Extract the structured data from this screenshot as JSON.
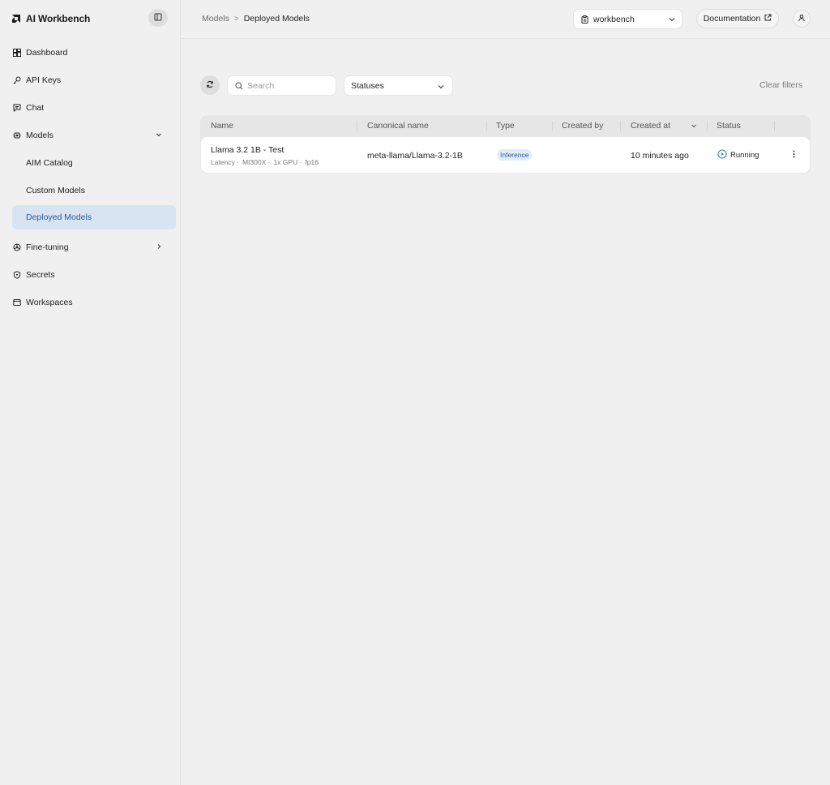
{
  "app": {
    "title": "AI Workbench"
  },
  "sidebar": {
    "items": [
      {
        "label": "Dashboard",
        "icon": "dashboard-icon"
      },
      {
        "label": "API Keys",
        "icon": "key-icon"
      },
      {
        "label": "Chat",
        "icon": "chat-icon"
      },
      {
        "label": "Models",
        "icon": "chip-icon",
        "expanded": true
      },
      {
        "label": "AIM Catalog"
      },
      {
        "label": "Custom Models"
      },
      {
        "label": "Deployed Models",
        "active": true
      },
      {
        "label": "Fine-tuning",
        "icon": "finetune-icon",
        "expanded": false
      },
      {
        "label": "Secrets",
        "icon": "shield-icon"
      },
      {
        "label": "Workspaces",
        "icon": "window-icon"
      }
    ]
  },
  "header": {
    "breadcrumb": {
      "parent": "Models",
      "separator": ">",
      "current": "Deployed Models"
    },
    "workspace": "workbench",
    "documentation": "Documentation"
  },
  "toolbar": {
    "search_placeholder": "Search",
    "status_select": "Statuses",
    "clear_filters": "Clear filters"
  },
  "table": {
    "columns": [
      "Name",
      "Canonical name",
      "Type",
      "Created by",
      "Created at",
      "Status"
    ],
    "rows": [
      {
        "name": "Llama 3.2 1B - Test",
        "meta": [
          "Latency ·",
          "MI300X ·",
          "1x GPU ·",
          "fp16"
        ],
        "canonical": "meta-llama/Llama-3.2-1B",
        "type": "Inference",
        "created_by": "",
        "created_at": "10 minutes ago",
        "status": "Running"
      }
    ]
  },
  "colors": {
    "accent": "#2b5a9a",
    "active_bg": "#d9e4f3",
    "status_running": "#2f7fc9"
  }
}
